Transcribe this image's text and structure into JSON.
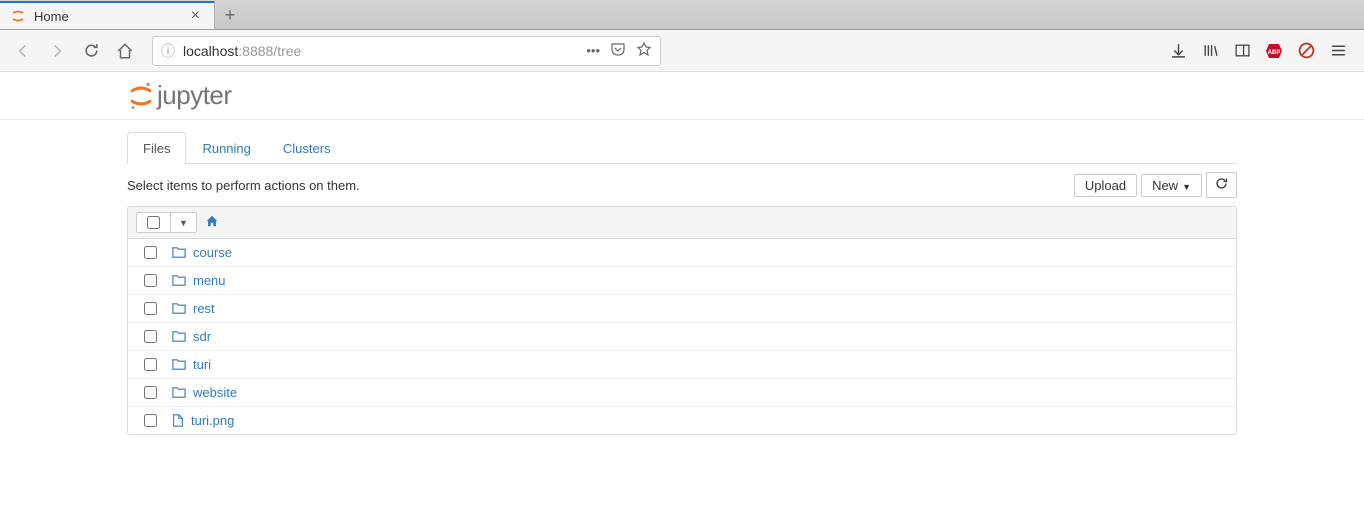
{
  "browser": {
    "tab_title": "Home",
    "url_host": "localhost",
    "url_rest": ":8888/tree"
  },
  "jupyter": {
    "logo_text": "jupyter",
    "tabs": {
      "files": "Files",
      "running": "Running",
      "clusters": "Clusters"
    },
    "hint": "Select items to perform actions on them.",
    "actions": {
      "upload": "Upload",
      "new": "New"
    },
    "items": [
      {
        "name": "course",
        "type": "folder"
      },
      {
        "name": "menu",
        "type": "folder"
      },
      {
        "name": "rest",
        "type": "folder"
      },
      {
        "name": "sdr",
        "type": "folder"
      },
      {
        "name": "turi",
        "type": "folder"
      },
      {
        "name": "website",
        "type": "folder"
      },
      {
        "name": "turi.png",
        "type": "file"
      }
    ]
  }
}
